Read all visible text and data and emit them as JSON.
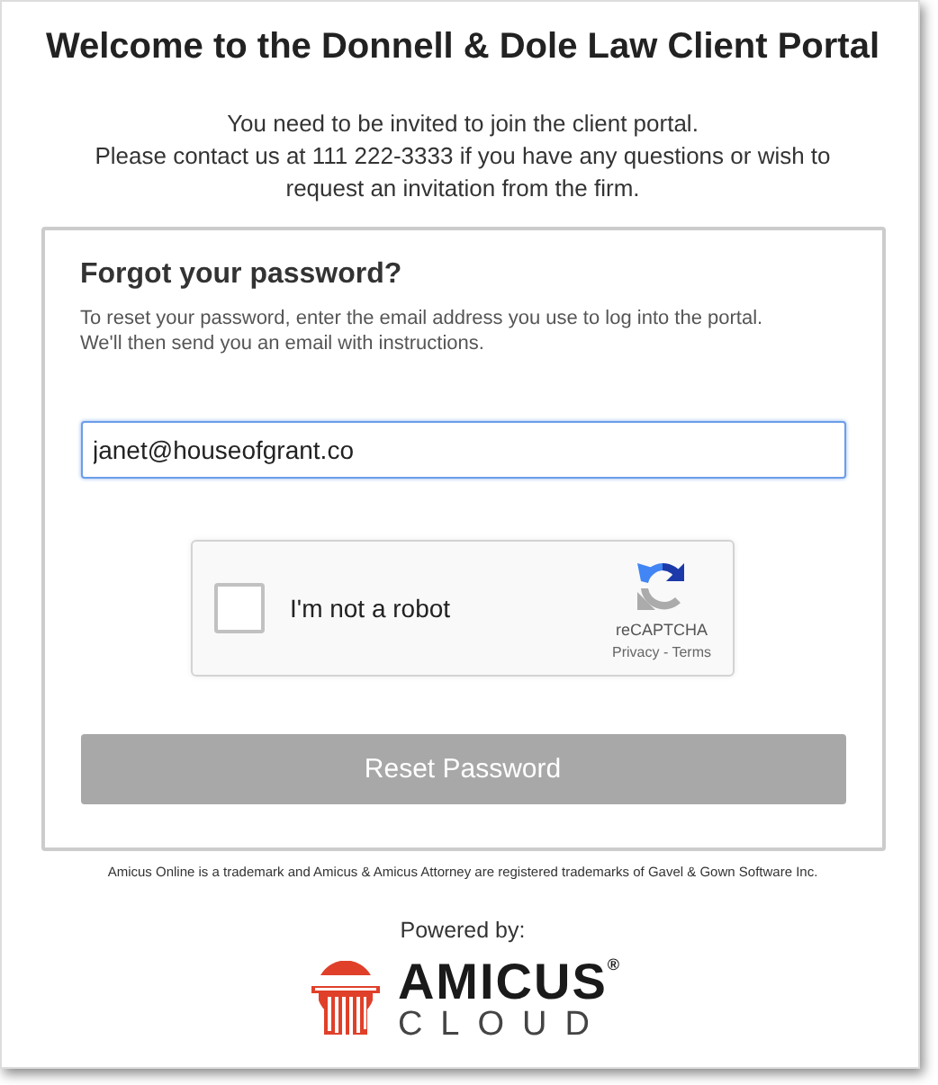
{
  "title": "Welcome to the Donnell & Dole Law Client Portal",
  "intro": [
    "You need to be invited to join the client portal.",
    "Please contact us at 111 222-3333 if you have any questions or wish to request an invitation from the firm."
  ],
  "form": {
    "heading": "Forgot your password?",
    "description": [
      "To reset your password, enter the email address you use to log into the portal.",
      "We'll then send you an email with instructions."
    ],
    "email": {
      "value": "janet@houseofgrant.co",
      "focused": true
    },
    "captcha": {
      "label": "I'm not a robot",
      "checked": false,
      "brand": "reCAPTCHA",
      "links": "Privacy - Terms"
    },
    "submit": {
      "label": "Reset Password",
      "disabled": true
    }
  },
  "trademark": "Amicus Online is a trademark and Amicus & Amicus Attorney are registered trademarks of Gavel & Gown Software Inc.",
  "powered_by": "Powered by:",
  "logo": {
    "name": "AMICUS",
    "mark": "®",
    "tagline": "CLOUD"
  }
}
